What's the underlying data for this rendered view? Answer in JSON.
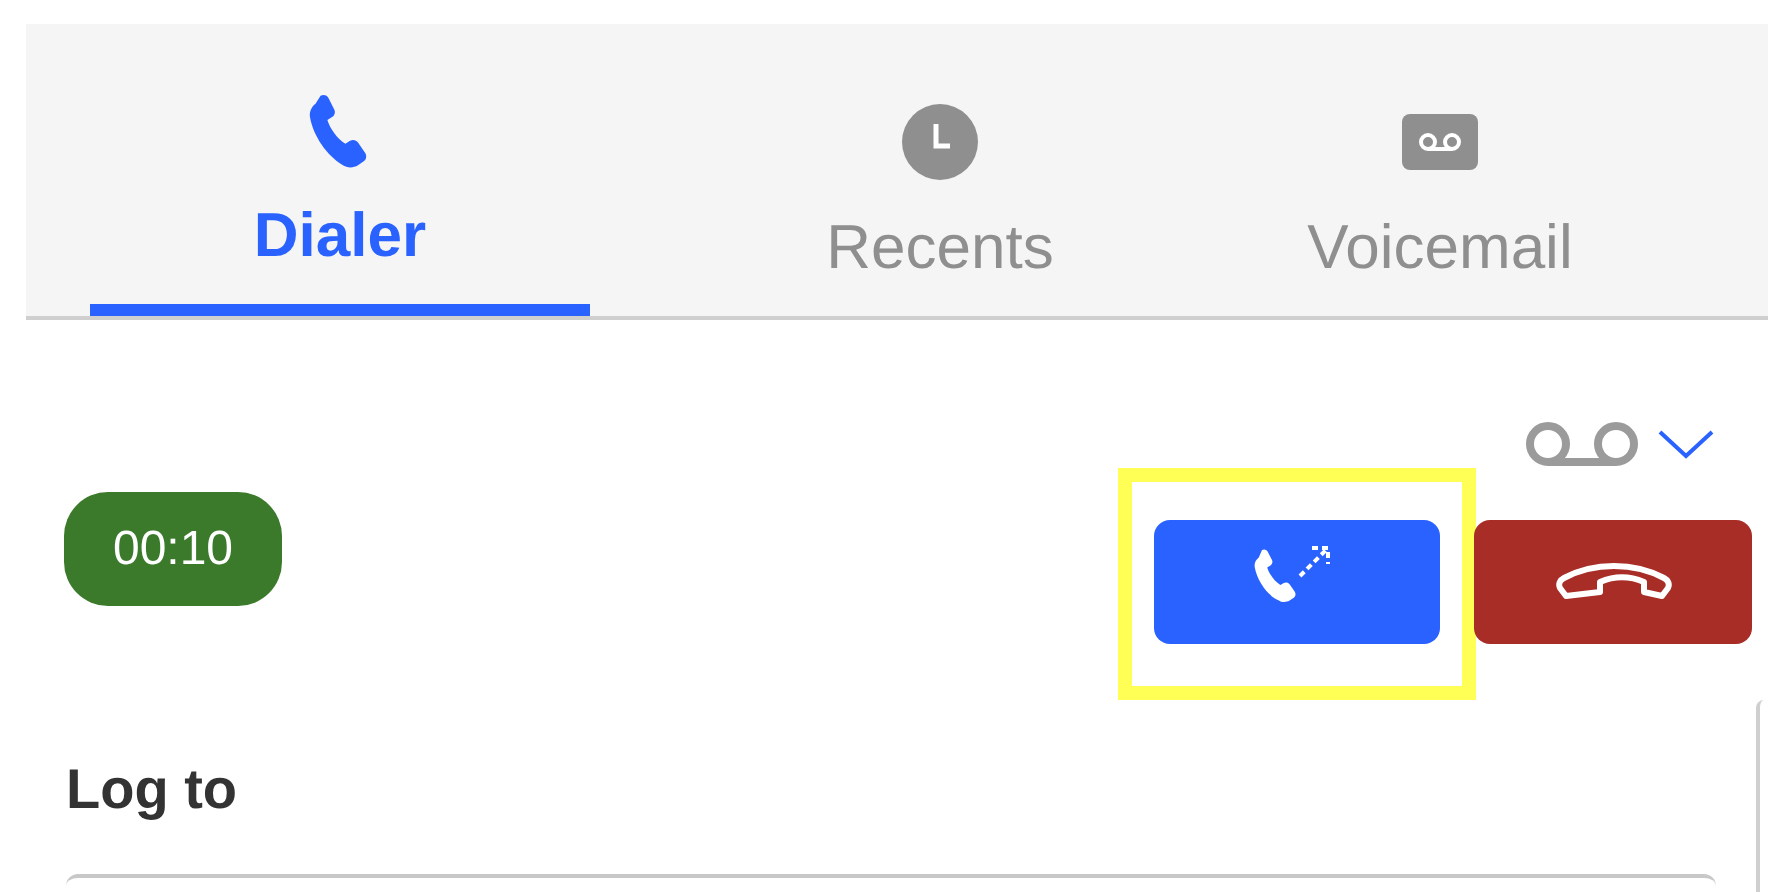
{
  "tabs": [
    {
      "label": "Dialer",
      "kind": "phone",
      "selected": true
    },
    {
      "label": "Recents",
      "kind": "clock",
      "selected": false
    },
    {
      "label": "Voicemail",
      "kind": "voicemail",
      "selected": false
    }
  ],
  "call": {
    "timer": "00:10",
    "transfer_button": {
      "highlighted": true
    }
  },
  "log_to": {
    "label": "Log to"
  }
}
